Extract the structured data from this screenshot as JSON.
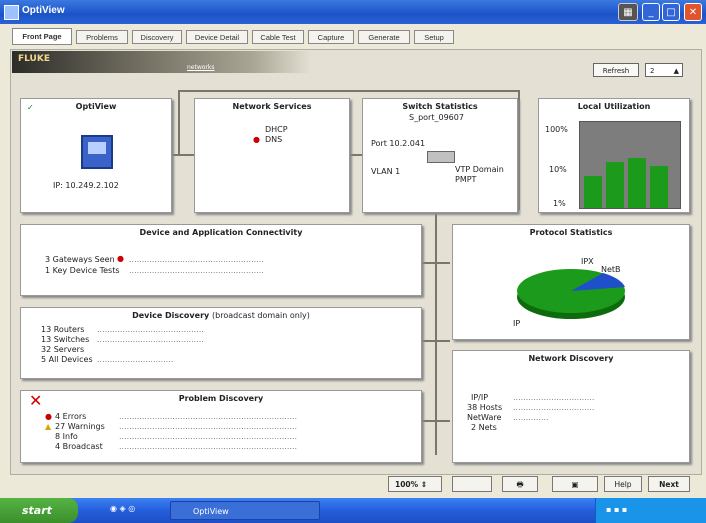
{
  "window": {
    "title": "OptiView"
  },
  "tabs": [
    "Front Page",
    "Problems",
    "Discovery",
    "Device Detail",
    "Cable Test",
    "Capture",
    "Generate",
    "Setup"
  ],
  "header": {
    "logo_text": "FLUKE",
    "link_text": "networks"
  },
  "refresh": {
    "label": "Refresh",
    "value": "2"
  },
  "optiview_panel": {
    "title": "OptiView",
    "ip": "IP: 10.249.2.102"
  },
  "network_services": {
    "title": "Network Services",
    "items": [
      "DHCP",
      "DNS"
    ]
  },
  "switch_stats": {
    "title": "Switch Statistics",
    "switch_name": "S_port_09607",
    "port": "Port 10.2.041",
    "vlan": "VLAN 1",
    "vtp_label": "VTP Domain",
    "vtp_value": "PMPT"
  },
  "local_utilization": {
    "title": "Local Utilization",
    "ticks": [
      "100%",
      "10%",
      "1%"
    ]
  },
  "connectivity": {
    "title": "Device and Application Connectivity",
    "rows": [
      "3 Gateways Seen",
      "1 Key Device Tests"
    ]
  },
  "protocol_stats": {
    "title": "Protocol Statistics",
    "labels": [
      "IPX",
      "IP",
      "NetB"
    ]
  },
  "device_discovery": {
    "title": "Device Discovery",
    "subtitle": "(broadcast domain only)",
    "rows": [
      "13 Routers",
      "13 Switches",
      "32 Servers",
      "5 All Devices"
    ]
  },
  "network_discovery": {
    "title": "Network Discovery",
    "rows": [
      "IP/IP",
      "38 Hosts",
      "NetWare",
      "2 Nets"
    ]
  },
  "problem_discovery": {
    "title": "Problem Discovery",
    "rows": [
      "4 Errors",
      "27 Warnings",
      "8 Info",
      "4 Broadcast"
    ]
  },
  "bottom_bar": {
    "zoom": "100%",
    "buttons": [
      "Help",
      "Next"
    ]
  },
  "taskbar": {
    "start": "start",
    "task": "OptiView"
  },
  "colors": {
    "green": "#1b9a1b",
    "blue": "#1f4fc9",
    "title_blue": "#245edb",
    "alarm_red": "#cc0000"
  }
}
